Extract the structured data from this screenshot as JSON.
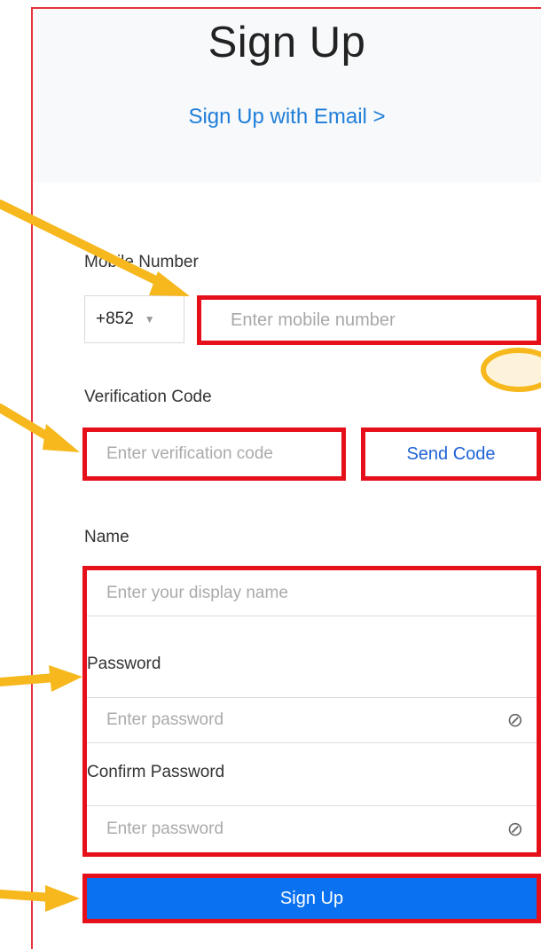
{
  "header": {
    "title": "Sign Up",
    "email_link": "Sign Up with Email >"
  },
  "mobile": {
    "label": "Mobile Number",
    "country_code": "+852",
    "placeholder": "Enter mobile number"
  },
  "verification": {
    "label": "Verification Code",
    "placeholder": "Enter verification code",
    "send_code": "Send Code"
  },
  "name": {
    "label": "Name",
    "placeholder": "Enter your display name"
  },
  "password": {
    "label": "Password",
    "placeholder": "Enter password"
  },
  "confirm_password": {
    "label": "Confirm Password",
    "placeholder": "Enter password"
  },
  "submit": {
    "label": "Sign Up"
  },
  "colors": {
    "annotation_red": "#e5101a",
    "arrow_yellow": "#f6b81d",
    "primary_blue": "#0a72f0",
    "link_blue": "#1f7ed8"
  }
}
